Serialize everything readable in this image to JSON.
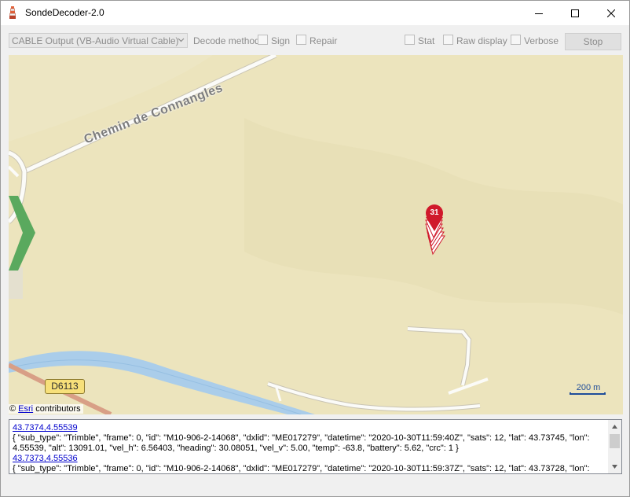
{
  "window": {
    "title": "SondeDecoder-2.0",
    "icons": {
      "app": "sonde-app-icon",
      "minimize": "minimize-icon",
      "maximize": "maximize-icon",
      "close": "close-icon"
    }
  },
  "toolbar": {
    "audio_device": "CABLE Output (VB-Audio Virtual Cable)",
    "decode_method_label": "Decode method",
    "sign_label": "Sign",
    "repair_label": "Repair",
    "stat_label": "Stat",
    "raw_display_label": "Raw display",
    "verbose_label": "Verbose",
    "stop_label": "Stop",
    "checkboxes": {
      "sign": false,
      "repair": false,
      "stat": false,
      "raw_display": false,
      "verbose": false
    }
  },
  "map": {
    "road_name": "Chemin de Connangles",
    "road_shield": "D6113",
    "marker_count": "31",
    "scale_label": "200 m",
    "attribution_prefix": "©",
    "attribution_link": "Esri",
    "attribution_suffix": "contributors",
    "colors": {
      "land": "#ece4bd",
      "water": "#aacdea",
      "marker": "#d0192b",
      "route": "#5aa95e"
    }
  },
  "log": {
    "entries": [
      {
        "coord": "43.7374,4.55539",
        "json": "{ \"sub_type\": \"Trimble\", \"frame\": 0, \"id\": \"M10-906-2-14068\", \"dxlid\": \"ME017279\", \"datetime\": \"2020-10-30T11:59:40Z\", \"sats\": 12, \"lat\": 43.73745, \"lon\": 4.55539, \"alt\": 13091.01, \"vel_h\": 6.56403, \"heading\": 30.08051, \"vel_v\": 5.00, \"temp\": -63.8, \"battery\": 5.62, \"crc\": 1 }"
      },
      {
        "coord": "43.7373,4.55536",
        "json": "{ \"sub_type\": \"Trimble\", \"frame\": 0, \"id\": \"M10-906-2-14068\", \"dxlid\": \"ME017279\", \"datetime\": \"2020-10-30T11:59:37Z\", \"sats\": 12, \"lat\": 43.73728, \"lon\":"
      }
    ]
  }
}
